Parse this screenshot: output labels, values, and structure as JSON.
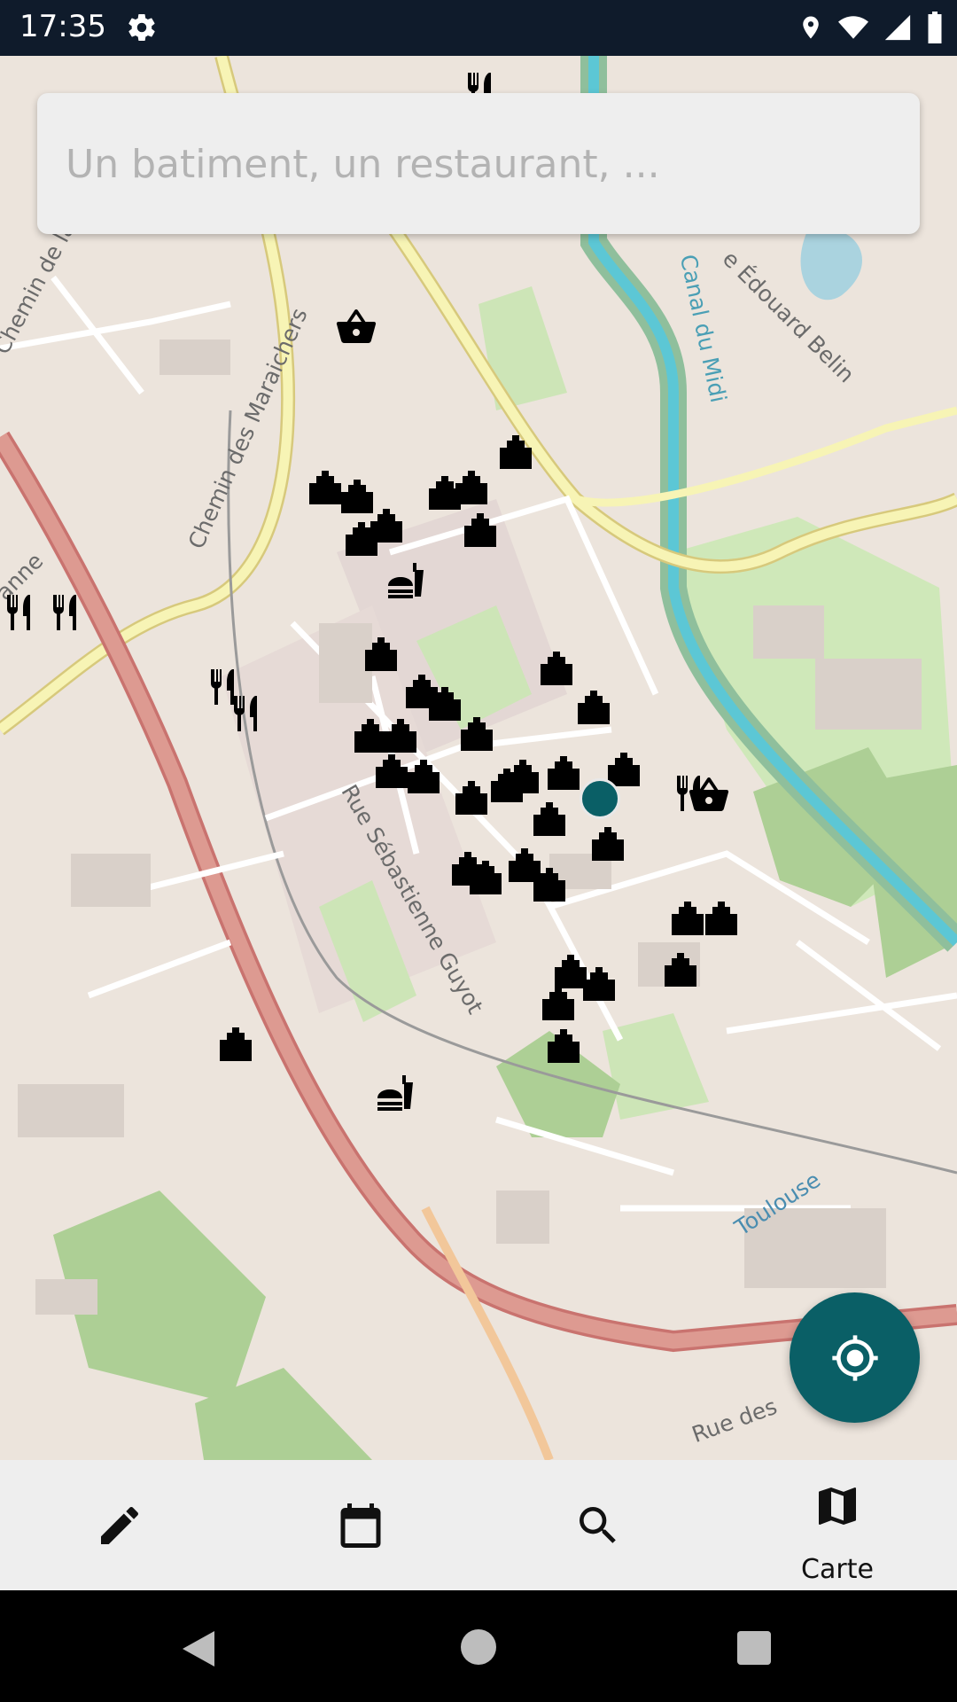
{
  "status_bar": {
    "time": "17:35",
    "icons": [
      "gear-icon",
      "location-icon",
      "wifi-icon",
      "signal-icon",
      "battery-icon"
    ]
  },
  "search": {
    "placeholder": "Un batiment, un restaurant, ..."
  },
  "map": {
    "street_labels": [
      "Chemin de la",
      "Chemin des Maraichers",
      "Canal du Midi",
      "e Édouard Belin",
      "Rue Sébastienne Guyot",
      "Toulouse",
      "Rue des",
      "anne"
    ],
    "poi_types": [
      "building-icon",
      "restaurant-icon",
      "fastfood-icon",
      "shop-basket-icon"
    ]
  },
  "bottom_nav": {
    "items": [
      {
        "icon": "pencil-icon",
        "label": ""
      },
      {
        "icon": "calendar-icon",
        "label": ""
      },
      {
        "icon": "search-icon",
        "label": ""
      },
      {
        "icon": "map-icon",
        "label": "Carte"
      }
    ],
    "active_index": 3
  },
  "colors": {
    "accent": "#0a5f66",
    "status_bar": "#0f1b2b",
    "nav_bg": "#eeeeee"
  }
}
